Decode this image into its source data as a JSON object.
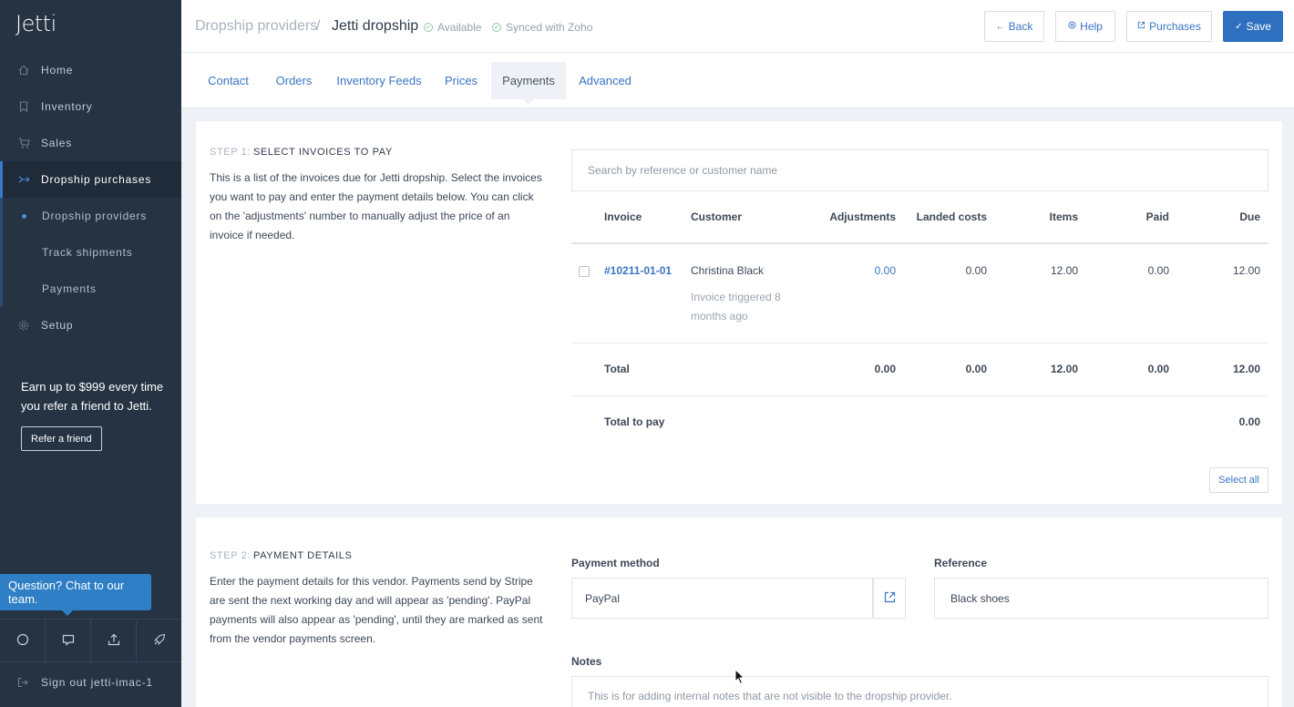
{
  "sidebar": {
    "logo": "Jetti",
    "nav": [
      {
        "label": "Home",
        "icon": "home-icon"
      },
      {
        "label": "Inventory",
        "icon": "bookmark-icon"
      },
      {
        "label": "Sales",
        "icon": "cart-icon"
      },
      {
        "label": "Dropship purchases",
        "icon": "dropship-icon",
        "active": true
      }
    ],
    "sub": [
      {
        "label": "Dropship providers",
        "active": true
      },
      {
        "label": "Track shipments"
      },
      {
        "label": "Payments"
      }
    ],
    "setup": "Setup",
    "promo": "Earn up to $999 every time you refer a friend to Jetti.",
    "refer_button": "Refer a friend",
    "chat": "Question? Chat to our team.",
    "signout": "Sign out jetti-imac-1"
  },
  "header": {
    "breadcrumb_parent": "Dropship providers",
    "breadcrumb_sep": "/",
    "title": "Jetti dropship",
    "status_available": "Available",
    "status_synced": "Synced with Zoho",
    "back": "Back",
    "help": "Help",
    "purchases": "Purchases",
    "save": "Save"
  },
  "tabs": [
    "Contact",
    "Orders",
    "Inventory Feeds",
    "Prices",
    "Payments",
    "Advanced"
  ],
  "active_tab": "Payments",
  "step1": {
    "step_label": "STEP 1:",
    "title": "SELECT INVOICES TO PAY",
    "description": "This is a list of the invoices due for Jetti dropship. Select the invoices you want to pay and enter the payment details below. You can click on the 'adjustments' number to manually adjust the price of an invoice if needed.",
    "search_placeholder": "Search by reference or customer name",
    "columns": {
      "invoice": "Invoice",
      "customer": "Customer",
      "adjustments": "Adjustments",
      "landed": "Landed costs",
      "items": "Items",
      "paid": "Paid",
      "due": "Due"
    },
    "row": {
      "invoice": "#10211-01-01",
      "customer": "Christina Black",
      "note": "Invoice triggered 8 months ago",
      "adjustments": "0.00",
      "landed": "0.00",
      "items": "12.00",
      "paid": "0.00",
      "due": "12.00"
    },
    "total": {
      "label": "Total",
      "adjustments": "0.00",
      "landed": "0.00",
      "items": "12.00",
      "paid": "0.00",
      "due": "12.00"
    },
    "total_to_pay": {
      "label": "Total to pay",
      "value": "0.00"
    },
    "select_all": "Select all"
  },
  "step2": {
    "step_label": "STEP 2:",
    "title": "PAYMENT DETAILS",
    "description": "Enter the payment details for this vendor. Payments send by Stripe are sent the next working day and will appear as 'pending'. PayPal payments will also appear as 'pending', until they are marked as sent from the vendor payments screen.",
    "payment_method_label": "Payment method",
    "payment_method_value": "PayPal",
    "reference_label": "Reference",
    "reference_value": "Black shoes",
    "notes_label": "Notes",
    "notes_placeholder": "This is for adding internal notes that are not visible to the dropship provider."
  },
  "colors": {
    "sidebar": "#253343",
    "accent": "#2f6fc0",
    "link": "#3a74c4",
    "chat": "#2e7fc5"
  }
}
